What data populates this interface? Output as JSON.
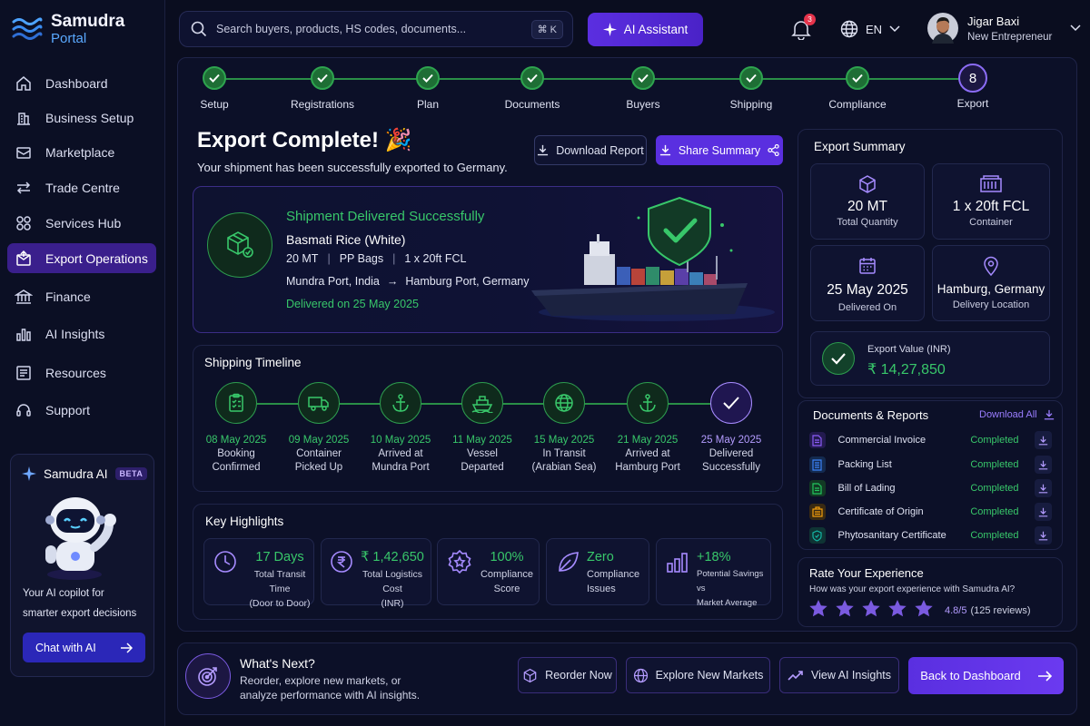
{
  "app": {
    "name_line1": "Samudra",
    "name_line2": "Portal"
  },
  "sidebar": {
    "items": [
      {
        "label": "Dashboard",
        "icon": "home-icon"
      },
      {
        "label": "Business Setup",
        "icon": "building-icon"
      },
      {
        "label": "Marketplace",
        "icon": "store-icon"
      },
      {
        "label": "Trade Centre",
        "icon": "exchange-icon"
      },
      {
        "label": "Services Hub",
        "icon": "grid-icon"
      },
      {
        "label": "Export Operations",
        "icon": "export-box-icon"
      },
      {
        "label": "Finance",
        "icon": "bank-icon"
      },
      {
        "label": "AI Insights",
        "icon": "bar-chart-icon"
      },
      {
        "label": "Resources",
        "icon": "book-icon"
      },
      {
        "label": "Support",
        "icon": "headset-icon"
      }
    ],
    "ai_card": {
      "title": "Samudra AI",
      "badge": "BETA",
      "description_line1": "Your AI copilot for",
      "description_line2": "smarter export decisions",
      "button": "Chat with AI"
    }
  },
  "topbar": {
    "search_placeholder": "Search buyers, products, HS codes, documents...",
    "shortcut": "⌘ K",
    "ai_button": "AI Assistant",
    "notification_count": "3",
    "language": "EN",
    "user_name": "Jigar Baxi",
    "user_role": "New Entrepreneur"
  },
  "stepper": {
    "steps": [
      "Setup",
      "Registrations",
      "Plan",
      "Documents",
      "Buyers",
      "Shipping",
      "Compliance",
      "Export"
    ],
    "current_number": "8"
  },
  "header": {
    "title": "Export Complete! 🎉",
    "subtitle": "Your shipment has been successfully exported to Germany.",
    "download_report": "Download Report",
    "share_summary": "Share Summary"
  },
  "delivery": {
    "status": "Shipment Delivered Successfully",
    "product": "Basmati Rice (White)",
    "quantity": "20 MT",
    "packaging": "PP Bags",
    "container": "1 x 20ft FCL",
    "origin": "Mundra Port, India",
    "arrow": "→",
    "destination": "Hamburg Port, Germany",
    "delivered_on": "Delivered on 25 May 2025"
  },
  "timeline": {
    "title": "Shipping Timeline",
    "events": [
      {
        "date": "08 May 2025",
        "line1": "Booking",
        "line2": "Confirmed",
        "icon": "clipboard-icon"
      },
      {
        "date": "09 May 2025",
        "line1": "Container",
        "line2": "Picked Up",
        "icon": "truck-icon"
      },
      {
        "date": "10 May 2025",
        "line1": "Arrived at",
        "line2": "Mundra Port",
        "icon": "anchor-icon"
      },
      {
        "date": "11 May 2025",
        "line1": "Vessel",
        "line2": "Departed",
        "icon": "ship-icon"
      },
      {
        "date": "15 May 2025",
        "line1": "In Transit",
        "line2": "(Arabian Sea)",
        "icon": "globe-icon"
      },
      {
        "date": "21 May 2025",
        "line1": "Arrived at",
        "line2": "Hamburg Port",
        "icon": "anchor-icon"
      },
      {
        "date": "25 May 2025",
        "line1": "Delivered",
        "line2": "Successfully",
        "icon": "check-icon"
      }
    ]
  },
  "highlights": {
    "title": "Key Highlights",
    "items": [
      {
        "value": "17 Days",
        "line1": "Total Transit Time",
        "line2": "(Door to Door)",
        "icon": "clock-icon"
      },
      {
        "value": "₹ 1,42,650",
        "line1": "Total Logistics Cost",
        "line2": "(INR)",
        "icon": "rupee-icon"
      },
      {
        "value": "100%",
        "line1": "Compliance",
        "line2": "Score",
        "icon": "badge-icon"
      },
      {
        "value": "Zero",
        "line1": "Compliance",
        "line2": "Issues",
        "icon": "leaf-icon"
      },
      {
        "value": "+18%",
        "line1": "Potential Savings vs",
        "line2": "Market Average",
        "icon": "bar-chart-icon"
      }
    ]
  },
  "summary": {
    "title": "Export Summary",
    "cards": [
      {
        "value": "20 MT",
        "label": "Total Quantity",
        "icon": "cube-icon"
      },
      {
        "value": "1 x 20ft FCL",
        "label": "Container",
        "icon": "container-icon"
      },
      {
        "value": "25 May 2025",
        "label": "Delivered On",
        "icon": "calendar-icon"
      },
      {
        "value": "Hamburg, Germany",
        "label": "Delivery Location",
        "icon": "map-pin-icon"
      }
    ],
    "export_value_label": "Export Value (INR)",
    "export_value": "₹ 14,27,850"
  },
  "documents": {
    "title": "Documents & Reports",
    "download_all": "Download All",
    "items": [
      {
        "name": "Commercial Invoice",
        "status": "Completed",
        "color": "#8b5cf6"
      },
      {
        "name": "Packing List",
        "status": "Completed",
        "color": "#3b82f6"
      },
      {
        "name": "Bill of Lading",
        "status": "Completed",
        "color": "#22c55e"
      },
      {
        "name": "Certificate of Origin",
        "status": "Completed",
        "color": "#f59e0b"
      },
      {
        "name": "Phytosanitary Certificate",
        "status": "Completed",
        "color": "#14b8a6"
      }
    ]
  },
  "rating": {
    "title": "Rate Your Experience",
    "question": "How was your export experience with Samudra AI?",
    "stars": 5,
    "score": "4.8/5",
    "reviews": "(125 reviews)"
  },
  "next": {
    "title": "What's Next?",
    "line1": "Reorder, explore new markets, or",
    "line2": "analyze performance with AI insights.",
    "reorder": "Reorder Now",
    "explore": "Explore New Markets",
    "insights": "View AI Insights",
    "back": "Back to Dashboard"
  },
  "colors": {
    "accent": "#5a2fe0",
    "success": "#38c76a",
    "background": "#0a0d1f"
  }
}
